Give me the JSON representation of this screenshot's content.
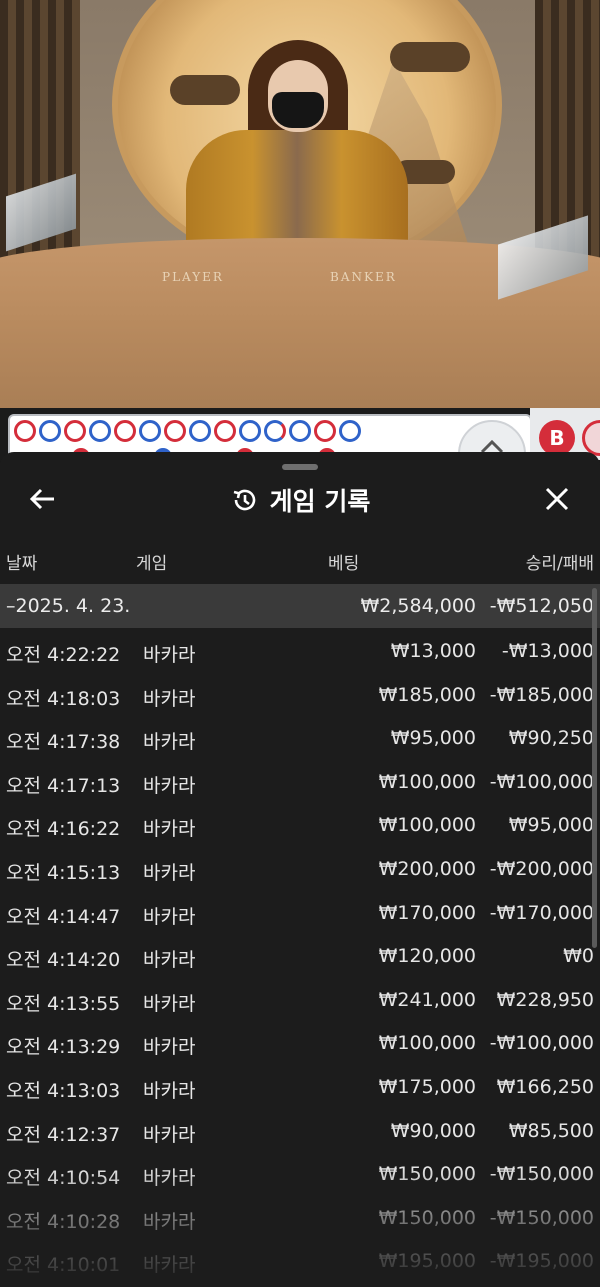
{
  "video": {
    "table_labels": [
      "PLAYER",
      "BANKER"
    ]
  },
  "roadmap": {
    "beads": [
      "red",
      "blue",
      "red",
      "blue",
      "red",
      "blue",
      "red",
      "blue",
      "red",
      "blue",
      "mix",
      "blue",
      "red",
      "blue"
    ],
    "badge": "B"
  },
  "panel": {
    "title": "게임 기록",
    "columns": {
      "date": "날짜",
      "game": "게임",
      "bet": "베팅",
      "winloss": "승리/패배"
    },
    "summary": {
      "date": "–2025. 4. 23.",
      "bet": "₩2,584,000",
      "winloss": "-₩512,050"
    },
    "rows": [
      {
        "time": "오전 4:22:22",
        "game": "바카라",
        "bet": "₩13,000",
        "winloss": "-₩13,000"
      },
      {
        "time": "오전 4:18:03",
        "game": "바카라",
        "bet": "₩185,000",
        "winloss": "-₩185,000"
      },
      {
        "time": "오전 4:17:38",
        "game": "바카라",
        "bet": "₩95,000",
        "winloss": "₩90,250"
      },
      {
        "time": "오전 4:17:13",
        "game": "바카라",
        "bet": "₩100,000",
        "winloss": "-₩100,000"
      },
      {
        "time": "오전 4:16:22",
        "game": "바카라",
        "bet": "₩100,000",
        "winloss": "₩95,000"
      },
      {
        "time": "오전 4:15:13",
        "game": "바카라",
        "bet": "₩200,000",
        "winloss": "-₩200,000"
      },
      {
        "time": "오전 4:14:47",
        "game": "바카라",
        "bet": "₩170,000",
        "winloss": "-₩170,000"
      },
      {
        "time": "오전 4:14:20",
        "game": "바카라",
        "bet": "₩120,000",
        "winloss": "₩0"
      },
      {
        "time": "오전 4:13:55",
        "game": "바카라",
        "bet": "₩241,000",
        "winloss": "₩228,950"
      },
      {
        "time": "오전 4:13:29",
        "game": "바카라",
        "bet": "₩100,000",
        "winloss": "-₩100,000"
      },
      {
        "time": "오전 4:13:03",
        "game": "바카라",
        "bet": "₩175,000",
        "winloss": "₩166,250"
      },
      {
        "time": "오전 4:12:37",
        "game": "바카라",
        "bet": "₩90,000",
        "winloss": "₩85,500"
      },
      {
        "time": "오전 4:10:54",
        "game": "바카라",
        "bet": "₩150,000",
        "winloss": "-₩150,000"
      },
      {
        "time": "오전 4:10:28",
        "game": "바카라",
        "bet": "₩150,000",
        "winloss": "-₩150,000"
      },
      {
        "time": "오전 4:10:01",
        "game": "바카라",
        "bet": "₩195,000",
        "winloss": "-₩195,000"
      }
    ]
  },
  "colors": {
    "panel_bg": "#1c1c1c",
    "summary_bg": "#3a3a3a",
    "text": "#e6e6e6",
    "banker_red": "#d42d3a",
    "player_blue": "#2f62c9"
  },
  "icons": {
    "back": "arrow-left-icon",
    "history": "history-clock-icon",
    "close": "close-icon",
    "scroll_up": "chevron-up-icon"
  }
}
